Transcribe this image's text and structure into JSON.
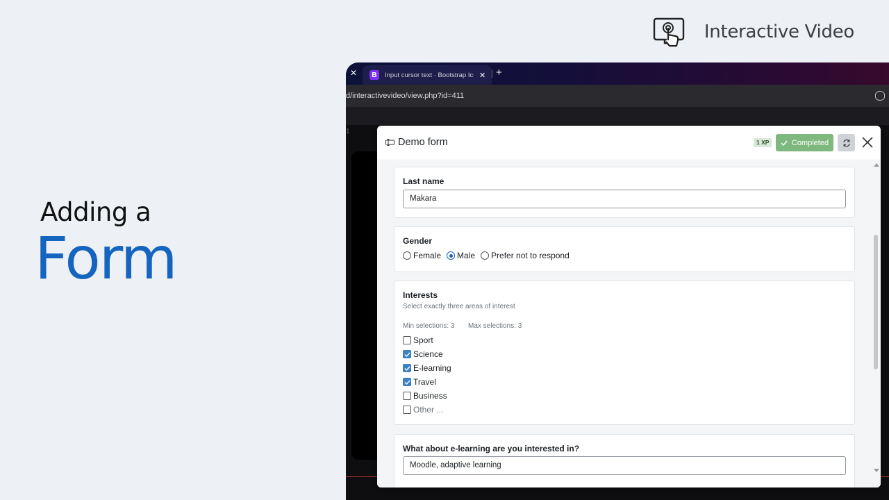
{
  "slide": {
    "title_small": "Adding a",
    "title_big": "Form",
    "brand_name": "Interactive Video"
  },
  "browser": {
    "tab_title": "Input cursor text · Bootstrap Ico",
    "tab_favicon": "B",
    "tab_close": "✕",
    "prev_tab_close": "✕",
    "new_tab": "+",
    "url": "d/interactivevideo/view.php?id=411",
    "strip_number": "1"
  },
  "modal": {
    "title": "Demo form",
    "xp_badge": "1 XP",
    "completed_label": "Completed",
    "accent_color": "#7fb87f"
  },
  "form": {
    "last_name": {
      "label": "Last name",
      "value": "Makara"
    },
    "gender": {
      "label": "Gender",
      "options": [
        {
          "label": "Female",
          "selected": false
        },
        {
          "label": "Male",
          "selected": true
        },
        {
          "label": "Prefer not to respond",
          "selected": false
        }
      ]
    },
    "interests": {
      "label": "Interests",
      "description": "Select exactly three areas of interest",
      "min_text": "Min selections: 3",
      "max_text": "Max selections: 3",
      "options": [
        {
          "label": "Sport",
          "checked": false
        },
        {
          "label": "Science",
          "checked": true
        },
        {
          "label": "E-learning",
          "checked": true
        },
        {
          "label": "Travel",
          "checked": true
        },
        {
          "label": "Business",
          "checked": false
        },
        {
          "label": "Other ...",
          "checked": false
        }
      ]
    },
    "elearning": {
      "label": "What about e-learning are you interested in?",
      "value": "Moodle, adaptive learning"
    }
  }
}
